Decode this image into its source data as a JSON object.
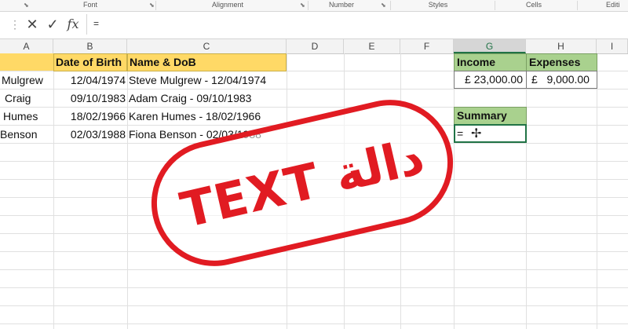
{
  "ribbon": {
    "groups": [
      "Font",
      "Alignment",
      "Number",
      "Styles",
      "Cells",
      "Editi"
    ]
  },
  "formula_bar": {
    "cancel_icon": "close-icon",
    "enter_icon": "check-icon",
    "fx_label": "fx",
    "content": "="
  },
  "columns": [
    "A",
    "B",
    "C",
    "D",
    "E",
    "F",
    "G",
    "H",
    "I"
  ],
  "table": {
    "headers": [
      "Date of Birth",
      "Name & DoB"
    ],
    "rows": [
      {
        "name": "Mulgrew",
        "dob": "12/04/1974",
        "combined": "Steve Mulgrew - 12/04/1974"
      },
      {
        "name": "Craig",
        "dob": "09/10/1983",
        "combined": "Adam Craig - 09/10/1983"
      },
      {
        "name": "Humes",
        "dob": "18/02/1966",
        "combined": "Karen Humes - 18/02/1966"
      },
      {
        "name": "Benson",
        "dob": "02/03/1988",
        "combined": "Fiona Benson - 02/03/1988"
      }
    ]
  },
  "finance": {
    "income_label": "Income",
    "expenses_label": "Expenses",
    "income_value": "£ 23,000.00",
    "expenses_value": "£   9,000.00",
    "summary_label": "Summary",
    "summary_value": "="
  },
  "stamp": {
    "text": "TEXT دالة",
    "color": "#e11b22"
  },
  "colors": {
    "accent": "#217346",
    "header_yellow": "#ffd966",
    "header_green": "#a9d18e"
  }
}
